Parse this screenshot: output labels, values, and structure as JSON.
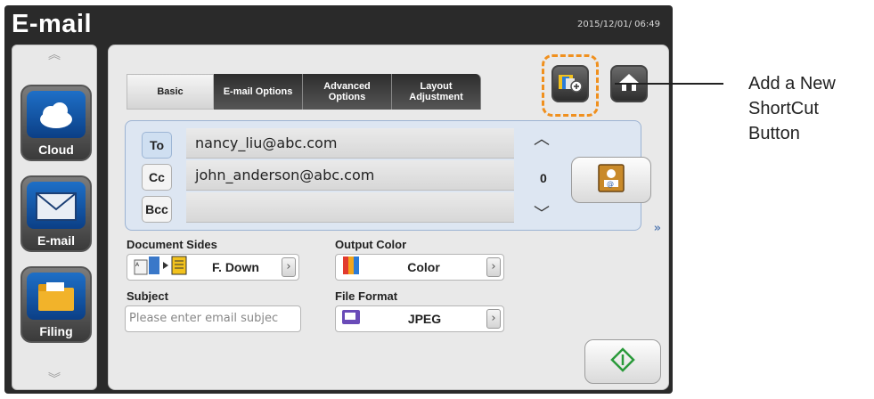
{
  "window": {
    "title": "E-mail",
    "datetime": "2015/12/01/ 06:49"
  },
  "sidebar": {
    "items": [
      {
        "label": "Cloud",
        "icon": "cloud-icon"
      },
      {
        "label": "E-mail",
        "icon": "envelope-icon"
      },
      {
        "label": "Filing",
        "icon": "folder-icon"
      }
    ]
  },
  "tabs": [
    {
      "label": "Basic",
      "active": true
    },
    {
      "label": "E-mail Options",
      "active": false
    },
    {
      "label": "Advanced Options",
      "active": false
    },
    {
      "label": "Layout Adjustment",
      "active": false
    }
  ],
  "shortcut_buttons": {
    "add_shortcut_icon": "add-shortcut-icon",
    "home_icon": "home-icon",
    "highlight_color": "#f0901e"
  },
  "recipients": {
    "to_label": "To",
    "cc_label": "Cc",
    "bcc_label": "Bcc",
    "to_value": "nancy_liu@abc.com",
    "cc_value": "john_anderson@abc.com",
    "bcc_value": "",
    "count": "0"
  },
  "settings": {
    "document_sides": {
      "label": "Document Sides",
      "value": "F. Down"
    },
    "output_color": {
      "label": "Output Color",
      "value": "Color"
    },
    "subject": {
      "label": "Subject",
      "placeholder": "Please enter email subjec"
    },
    "file_format": {
      "label": "File Format",
      "value": "JPEG"
    }
  },
  "more_indicator": "»",
  "callout": {
    "line1": "Add a New",
    "line2": "ShortCut",
    "line3": "Button"
  }
}
